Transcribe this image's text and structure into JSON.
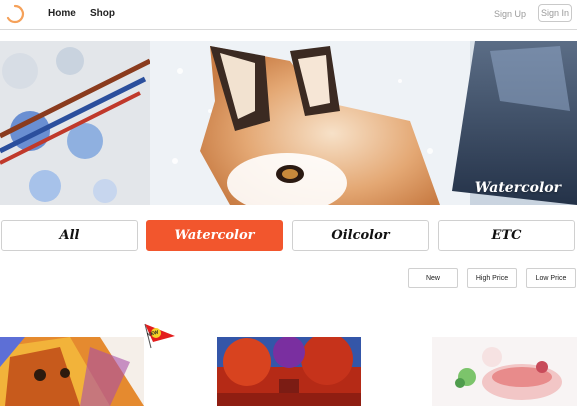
{
  "nav": {
    "home_label": "Home",
    "shop_label": "Shop",
    "signup_label": "Sign Up",
    "signin_label": "Sign In"
  },
  "banner": {
    "label": "Watercolor"
  },
  "categories": [
    {
      "label": "All",
      "active": false
    },
    {
      "label": "Watercolor",
      "active": true
    },
    {
      "label": "Oilcolor",
      "active": false
    },
    {
      "label": "ETC",
      "active": false
    }
  ],
  "sort": {
    "new_label": "New",
    "high_label": "High Price",
    "low_label": "Low Price"
  },
  "products": [
    {
      "badge": "NEW"
    },
    {},
    {}
  ],
  "colors": {
    "accent": "#f2562d",
    "muted_text": "#9a9a9a",
    "border": "#d0d0d0"
  }
}
